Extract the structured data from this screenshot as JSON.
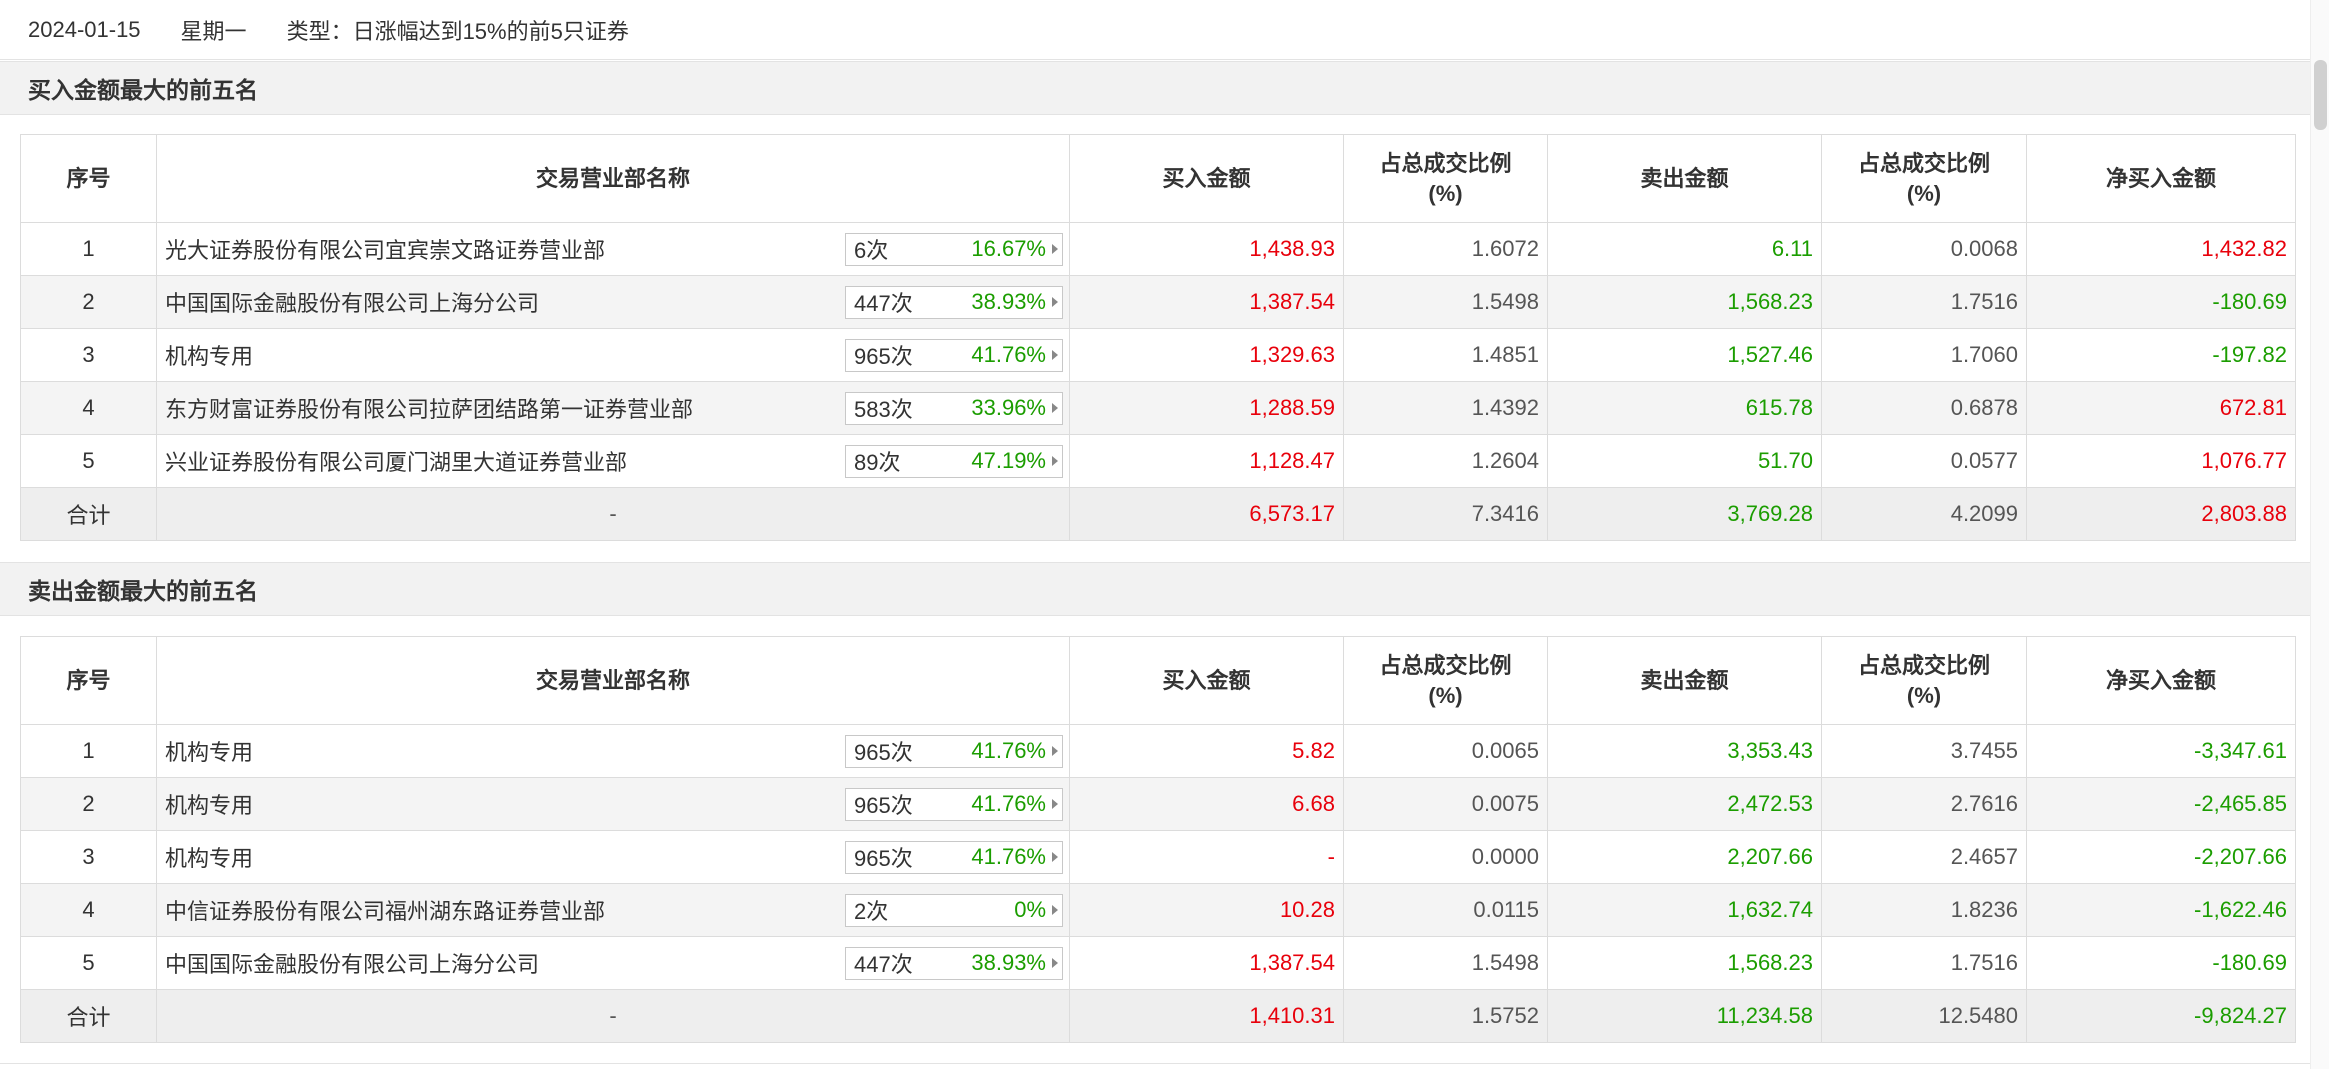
{
  "header": {
    "date": "2024-01-15",
    "weekday": "星期一",
    "type": "类型：日涨幅达到15%的前5只证券"
  },
  "columns": {
    "rank": "序号",
    "name": "交易营业部名称",
    "buy": "买入金额",
    "buy_ratio_1": "占总成交比例",
    "buy_ratio_2": "(%)",
    "sell": "卖出金额",
    "sell_ratio_1": "占总成交比例",
    "sell_ratio_2": "(%)",
    "net": "净买入金额"
  },
  "section1": {
    "title": "买入金额最大的前五名",
    "rows": [
      {
        "rank": "1",
        "name": "光大证券股份有限公司宜宾崇文路证券营业部",
        "times": "6次",
        "pct": "16.67%",
        "buy": "1,438.93",
        "buy_ratio": "1.6072",
        "sell": "6.11",
        "sell_ratio": "0.0068",
        "net": "1,432.82"
      },
      {
        "rank": "2",
        "name": "中国国际金融股份有限公司上海分公司",
        "times": "447次",
        "pct": "38.93%",
        "buy": "1,387.54",
        "buy_ratio": "1.5498",
        "sell": "1,568.23",
        "sell_ratio": "1.7516",
        "net": "-180.69"
      },
      {
        "rank": "3",
        "name": "机构专用",
        "times": "965次",
        "pct": "41.76%",
        "buy": "1,329.63",
        "buy_ratio": "1.4851",
        "sell": "1,527.46",
        "sell_ratio": "1.7060",
        "net": "-197.82"
      },
      {
        "rank": "4",
        "name": "东方财富证券股份有限公司拉萨团结路第一证券营业部",
        "times": "583次",
        "pct": "33.96%",
        "buy": "1,288.59",
        "buy_ratio": "1.4392",
        "sell": "615.78",
        "sell_ratio": "0.6878",
        "net": "672.81"
      },
      {
        "rank": "5",
        "name": "兴业证券股份有限公司厦门湖里大道证券营业部",
        "times": "89次",
        "pct": "47.19%",
        "buy": "1,128.47",
        "buy_ratio": "1.2604",
        "sell": "51.70",
        "sell_ratio": "0.0577",
        "net": "1,076.77"
      }
    ],
    "total": {
      "label": "合计",
      "name": "-",
      "buy": "6,573.17",
      "buy_ratio": "7.3416",
      "sell": "3,769.28",
      "sell_ratio": "4.2099",
      "net": "2,803.88"
    }
  },
  "section2": {
    "title": "卖出金额最大的前五名",
    "rows": [
      {
        "rank": "1",
        "name": "机构专用",
        "times": "965次",
        "pct": "41.76%",
        "buy": "5.82",
        "buy_ratio": "0.0065",
        "sell": "3,353.43",
        "sell_ratio": "3.7455",
        "net": "-3,347.61"
      },
      {
        "rank": "2",
        "name": "机构专用",
        "times": "965次",
        "pct": "41.76%",
        "buy": "6.68",
        "buy_ratio": "0.0075",
        "sell": "2,472.53",
        "sell_ratio": "2.7616",
        "net": "-2,465.85"
      },
      {
        "rank": "3",
        "name": "机构专用",
        "times": "965次",
        "pct": "41.76%",
        "buy": "-",
        "buy_ratio": "0.0000",
        "sell": "2,207.66",
        "sell_ratio": "2.4657",
        "net": "-2,207.66"
      },
      {
        "rank": "4",
        "name": "中信证券股份有限公司福州湖东路证券营业部",
        "times": "2次",
        "pct": "0%",
        "buy": "10.28",
        "buy_ratio": "0.0115",
        "sell": "1,632.74",
        "sell_ratio": "1.8236",
        "net": "-1,622.46"
      },
      {
        "rank": "5",
        "name": "中国国际金融股份有限公司上海分公司",
        "times": "447次",
        "pct": "38.93%",
        "buy": "1,387.54",
        "buy_ratio": "1.5498",
        "sell": "1,568.23",
        "sell_ratio": "1.7516",
        "net": "-180.69"
      }
    ],
    "total": {
      "label": "合计",
      "name": "-",
      "buy": "1,410.31",
      "buy_ratio": "1.5752",
      "sell": "11,234.58",
      "sell_ratio": "12.5480",
      "net": "-9,824.27"
    }
  },
  "colors": {
    "positive": "#e8000b",
    "negative": "#1b9d00",
    "header_bg": "#f2f2f2"
  }
}
